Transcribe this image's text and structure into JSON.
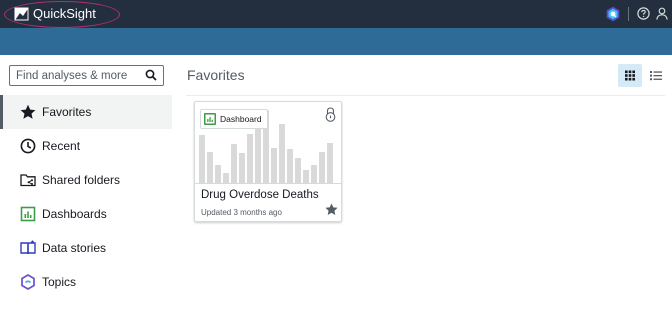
{
  "topbar": {
    "app_title": "QuickSight",
    "icons": [
      "quicksight-logo-icon",
      "amazon-q-icon",
      "help-icon",
      "user-icon"
    ]
  },
  "sidebar": {
    "search": {
      "placeholder": "Find analyses & more",
      "value": ""
    },
    "items": [
      {
        "label": "Favorites",
        "icon": "star-icon",
        "active": true
      },
      {
        "label": "Recent",
        "icon": "clock-icon",
        "active": false
      },
      {
        "label": "Shared folders",
        "icon": "shared-folder-icon",
        "active": false
      },
      {
        "label": "Dashboards",
        "icon": "dashboard-icon",
        "active": false
      },
      {
        "label": "Data stories",
        "icon": "book-icon",
        "active": false
      },
      {
        "label": "Topics",
        "icon": "topics-icon",
        "active": false
      }
    ]
  },
  "main": {
    "title": "Favorites",
    "view_mode": "grid",
    "cards": [
      {
        "badge": "Dashboard",
        "title": "Drug Overdose Deaths",
        "subtitle": "Updated 3 months ago",
        "favorited": true,
        "locked": true
      }
    ]
  },
  "colors": {
    "topbar": "#232f3e",
    "bluebar": "#2e6c97",
    "logo_highlight": "#b0326b",
    "dashboard_green": "#3b9e46",
    "grid_view_active": "#d5e9f6"
  }
}
